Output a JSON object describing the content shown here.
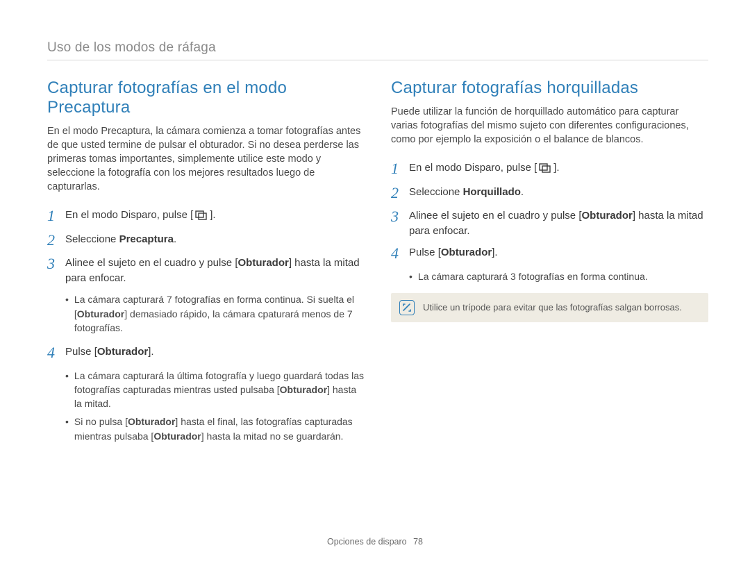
{
  "breadcrumb": "Uso de los modos de ráfaga",
  "footer": {
    "label": "Opciones de disparo",
    "page": "78"
  },
  "icons": {
    "burst_alt": "burst-mode-icon",
    "note_alt": "note-icon"
  },
  "left": {
    "heading": "Capturar fotografías en el modo Precaptura",
    "intro": "En el modo Precaptura, la cámara comienza a tomar fotografías antes de que usted termine de pulsar el obturador. Si no desea perderse las primeras tomas importantes, simplemente utilice este modo y seleccione la fotografía con los mejores resultados luego de capturarlas.",
    "s1a": "En el modo Disparo, pulse [",
    "s1b": "].",
    "s2a": "Seleccione ",
    "s2b": "Precaptura",
    "s2c": ".",
    "s3a": "Alinee el sujeto en el cuadro y pulse [",
    "s3b": "Obturador",
    "s3c": "] hasta la mitad para enfocar.",
    "s3sub1a": "La cámara capturará 7 fotografías en forma continua. Si suelta el [",
    "s3sub1b": "Obturador",
    "s3sub1c": "] demasiado rápido, la cámara cpaturará menos de 7 fotografías.",
    "s4a": "Pulse [",
    "s4b": "Obturador",
    "s4c": "].",
    "s4sub1a": "La cámara capturará la última fotografía y luego guardará todas las fotografías capturadas mientras usted pulsaba [",
    "s4sub1b": "Obturador",
    "s4sub1c": "] hasta la mitad.",
    "s4sub2a": "Si no pulsa [",
    "s4sub2b": "Obturador",
    "s4sub2c": "] hasta el final, las fotografías capturadas mientras pulsaba [",
    "s4sub2d": "Obturador",
    "s4sub2e": "] hasta la mitad no se guardarán."
  },
  "right": {
    "heading": "Capturar fotografías horquilladas",
    "intro": "Puede utilizar la función de horquillado automático para capturar varias fotografías del mismo sujeto con diferentes configuraciones, como por ejemplo la exposición o el balance de blancos.",
    "s1a": "En el modo Disparo, pulse [",
    "s1b": "].",
    "s2a": "Seleccione ",
    "s2b": "Horquillado",
    "s2c": ".",
    "s3a": "Alinee el sujeto en el cuadro y pulse [",
    "s3b": "Obturador",
    "s3c": "] hasta la mitad para enfocar.",
    "s4a": "Pulse [",
    "s4b": "Obturador",
    "s4c": "].",
    "s4sub1": "La cámara capturará 3 fotografías en forma continua.",
    "note": "Utilice un trípode para evitar que las fotografías salgan borrosas."
  }
}
